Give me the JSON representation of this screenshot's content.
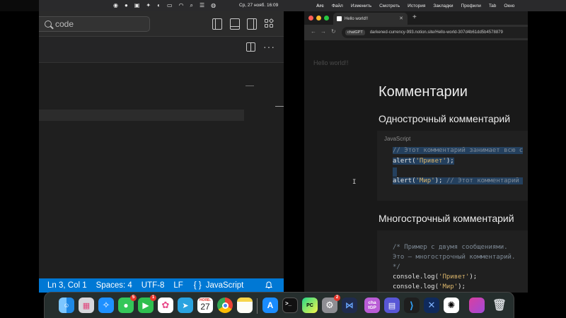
{
  "menubar": {
    "datetime": "Ср, 27 нояб.  16:09",
    "app_name": "Arc",
    "menus": [
      "Файл",
      "Изменить",
      "Смотреть",
      "История",
      "Закладки",
      "Профили",
      "Tab",
      "Окно"
    ],
    "status_icons": [
      "copilot-icon",
      "wechat-icon",
      "window-icon",
      "pin-icon",
      "play-icon",
      "battery-icon",
      "wifi-icon",
      "search-icon",
      "control-center-icon",
      "siri-icon"
    ]
  },
  "vscode": {
    "search_placeholder": "code",
    "status": {
      "position": "Ln 3, Col 1",
      "spaces": "Spaces: 4",
      "encoding": "UTF-8",
      "eol": "LF",
      "braces": "{ }",
      "language": "JavaScript"
    },
    "accent": "#0078d4"
  },
  "browser": {
    "tab_title": "Hello world!!",
    "url_chip": "chatGPT",
    "url": "darkened-currency-993.notion.site/Hello-world-307d4b61dd5b4578879",
    "breadcrumb": "Hello world!!",
    "heading1": "Комментарии",
    "section1_title": "Однострочный комментарий",
    "code1_lang": "JavaScript",
    "code1_lines": {
      "l1_comment": "// Этот комментарий занимает всю с",
      "l2_fn": "alert(",
      "l2_str": "'Привет'",
      "l2_end": ");",
      "l4_fn": "alert(",
      "l4_str": "'Мир'",
      "l4_mid": "); ",
      "l4_comment": "// Этот комментарий "
    },
    "section2_title": "Многострочный комментарий",
    "code2_lines": {
      "l1": "/* Пример с двумя сообщениями.",
      "l2": "Это – многострочный комментарий.",
      "l3": "*/",
      "l4_fn": "console.log(",
      "l4_str": "'Привет'",
      "l4_end": ");",
      "l5_fn": "console.log(",
      "l5_str": "'Мир'",
      "l5_end": ");"
    }
  },
  "dock": {
    "calendar_month": "НОЯБ.",
    "calendar_day": "27",
    "chatgpt_label": "cha tGP",
    "badges": {
      "messages": "5",
      "facetime": "1",
      "settings": "2"
    },
    "apps": [
      "finder",
      "launchpad",
      "safari",
      "messages",
      "facetime",
      "photos",
      "telegram",
      "calendar",
      "chrome",
      "notes",
      "app-store",
      "terminal",
      "pycharm",
      "system-settings",
      "linear",
      "chatgpt-web",
      "preview",
      "vscode",
      "arc",
      "chatgpt",
      "photo-booth",
      "trash"
    ]
  }
}
